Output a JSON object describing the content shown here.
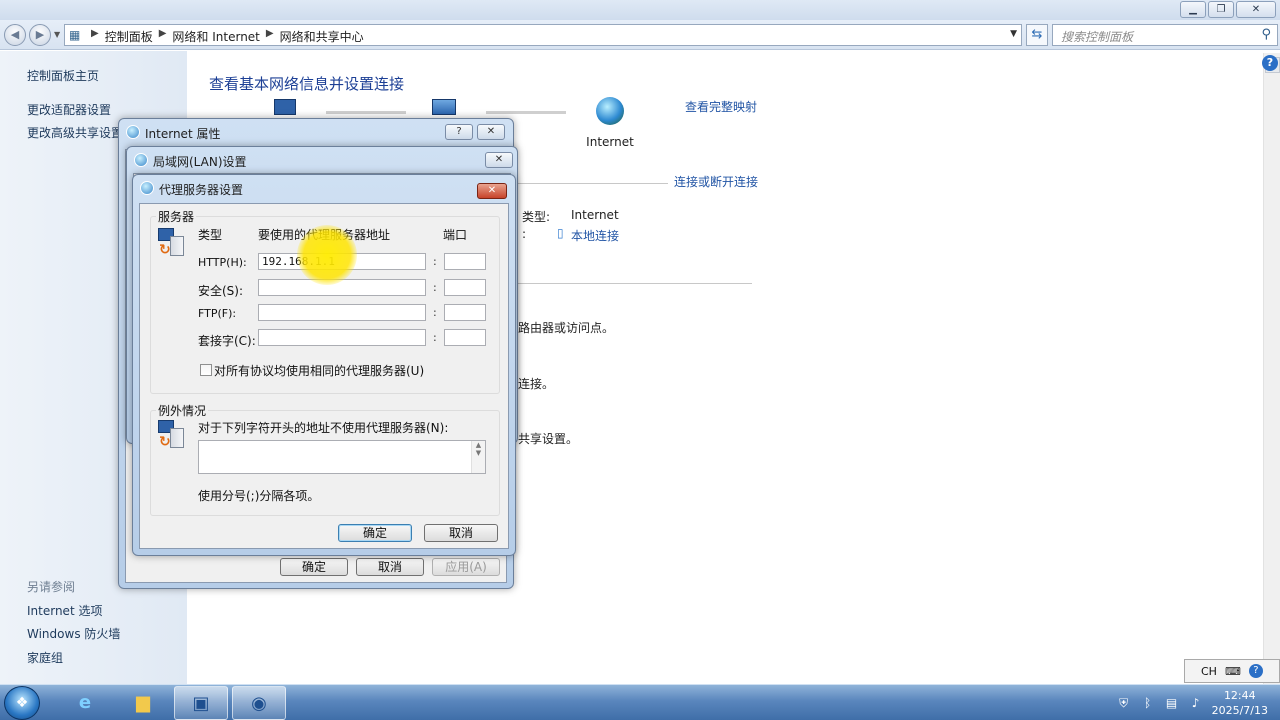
{
  "window": {
    "minimize_glyph": "▁",
    "restore_glyph": "❐",
    "close_glyph": "✕"
  },
  "address": {
    "crumbs": [
      "控制面板",
      "网络和 Internet",
      "网络和共享中心"
    ],
    "search_placeholder": "搜索控制面板"
  },
  "left_pane": {
    "home": "控制面板主页",
    "items": [
      "更改适配器设置",
      "更改高级共享设置"
    ],
    "see_also_title": "另请参阅",
    "see_also": [
      "Internet 选项",
      "Windows 防火墙",
      "家庭组"
    ]
  },
  "main": {
    "heading": "查看基本网络信息并设置连接",
    "internet_label": "Internet",
    "view_full_map": "查看完整映射",
    "connect_disconnect": "连接或断开连接",
    "type_label": "类型:",
    "type_value": "Internet",
    "conn_label": ":",
    "conn_value": "本地连接",
    "frag1": "路由器或访问点。",
    "frag2": "连接。",
    "frag3": "共享设置。"
  },
  "dlg_internet": {
    "title": "Internet 属性",
    "help_glyph": "?",
    "ok": "确定",
    "cancel": "取消",
    "apply": "应用(A)"
  },
  "dlg_lan": {
    "title": "局域网(LAN)设置"
  },
  "dlg_proxy": {
    "title": "代理服务器设置",
    "servers_group": "服务器",
    "col_type": "类型",
    "col_address": "要使用的代理服务器地址",
    "col_port": "端口",
    "rows": [
      {
        "label": "HTTP(H):",
        "address": "192.168.1.1",
        "port": ""
      },
      {
        "label": "安全(S):",
        "address": "",
        "port": ""
      },
      {
        "label": "FTP(F):",
        "address": "",
        "port": ""
      },
      {
        "label": "套接字(C):",
        "address": "",
        "port": ""
      }
    ],
    "same_proxy": "对所有协议均使用相同的代理服务器(U)",
    "exceptions_group": "例外情况",
    "exceptions_desc": "对于下列字符开头的地址不使用代理服务器(N):",
    "exceptions_value": "",
    "exceptions_hint": "使用分号(;)分隔各项。",
    "ok": "确定",
    "cancel": "取消"
  },
  "taskbar": {
    "lang": "CH",
    "time": "12:44",
    "date": "2025/7/13"
  }
}
